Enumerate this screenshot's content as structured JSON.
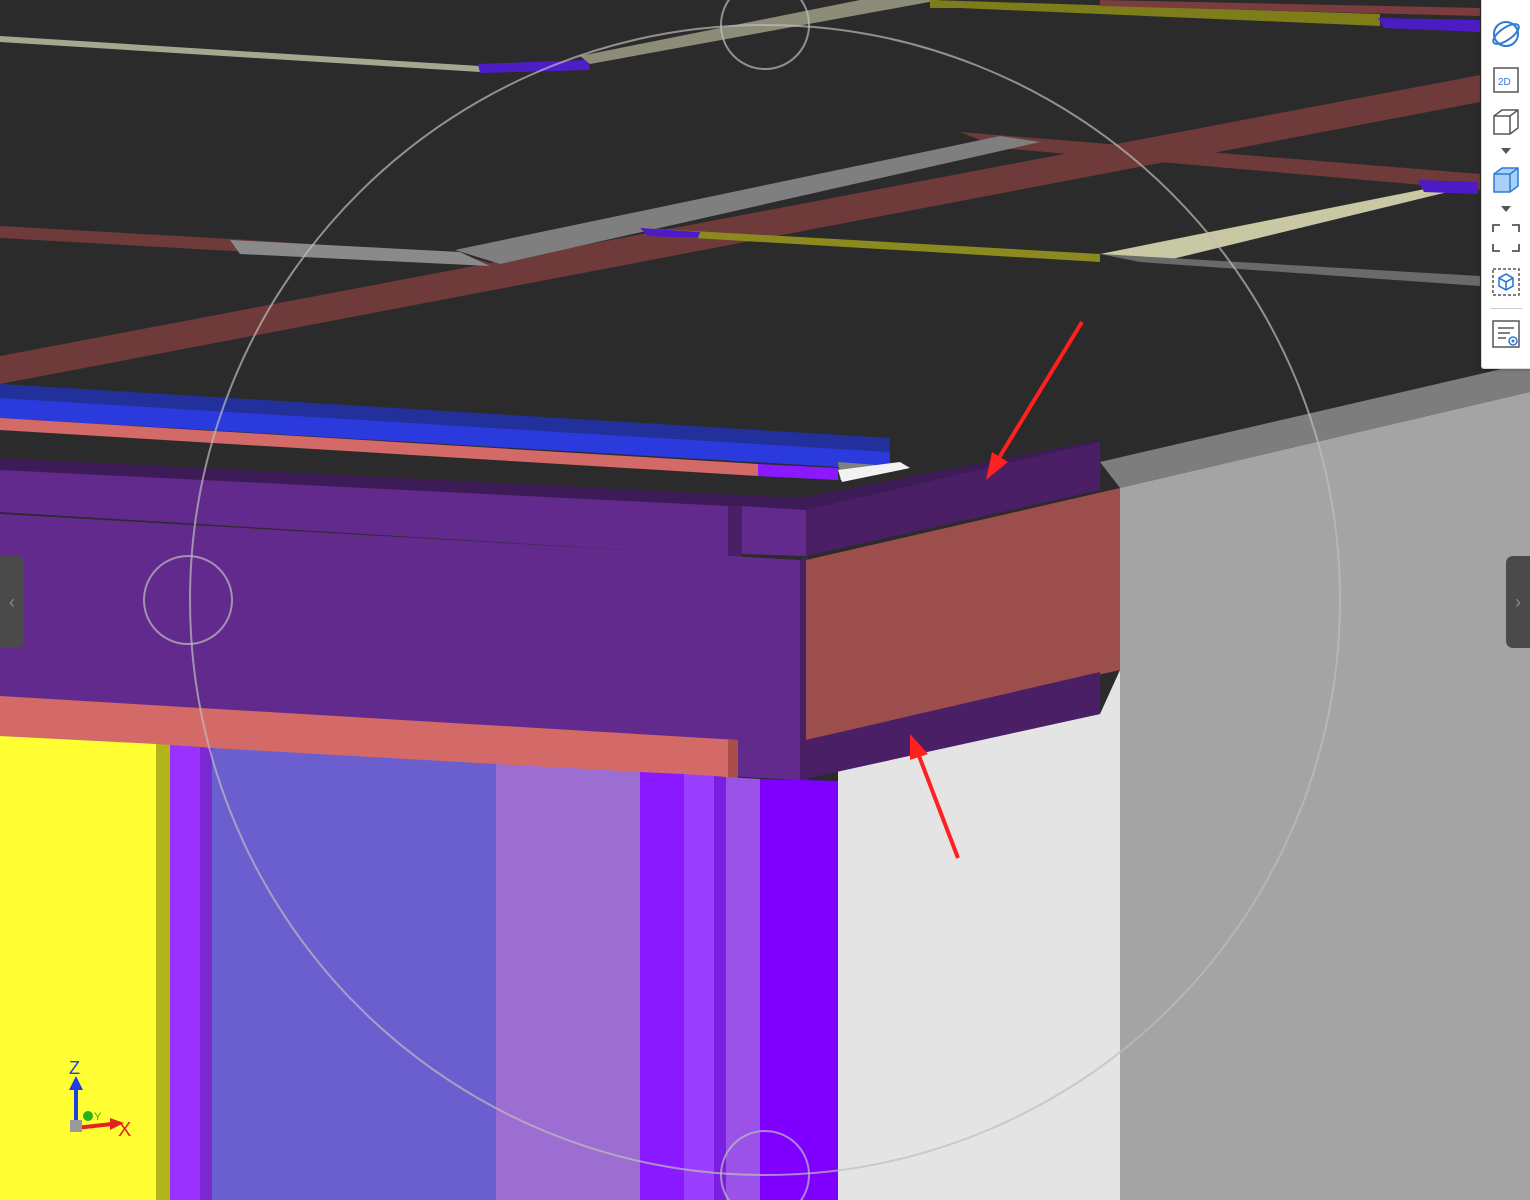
{
  "axis_labels": {
    "z": "Z",
    "y": "Y",
    "x": "X"
  },
  "toolbar": {
    "items": [
      {
        "icon": "orbit-icon",
        "label": ""
      },
      {
        "icon": "2d-view-icon",
        "label": "2D"
      },
      {
        "icon": "3d-view-icon",
        "label": ""
      },
      {
        "icon": "solid-view-icon",
        "label": ""
      },
      {
        "icon": "zoom-extents-icon",
        "label": ""
      },
      {
        "icon": "isolate-icon",
        "label": ""
      },
      {
        "icon": "properties-icon",
        "label": ""
      }
    ]
  },
  "side_handles": {
    "left": "‹",
    "right": "›"
  },
  "colors": {
    "background": "#2b2b2b",
    "slab_top": "#2a2a2a",
    "beam_purple": "#632a8e",
    "beam_purple_dark": "#4a1f66",
    "beam_red": "#9b4e4c",
    "beam_salmon": "#d46a67",
    "blue_bar": "#2b3adc",
    "yellow_column": "#ffff33",
    "violet_wall": "#6b5fd0",
    "lilac_wall": "#9d6ed2",
    "bright_violet": "#8a19ff",
    "light_panel": "#e4e4e4",
    "grey_wall": "#a4a4a4",
    "annotation_arrow": "#ff2020",
    "toolbar_icon_blue": "#2e7bd6"
  }
}
